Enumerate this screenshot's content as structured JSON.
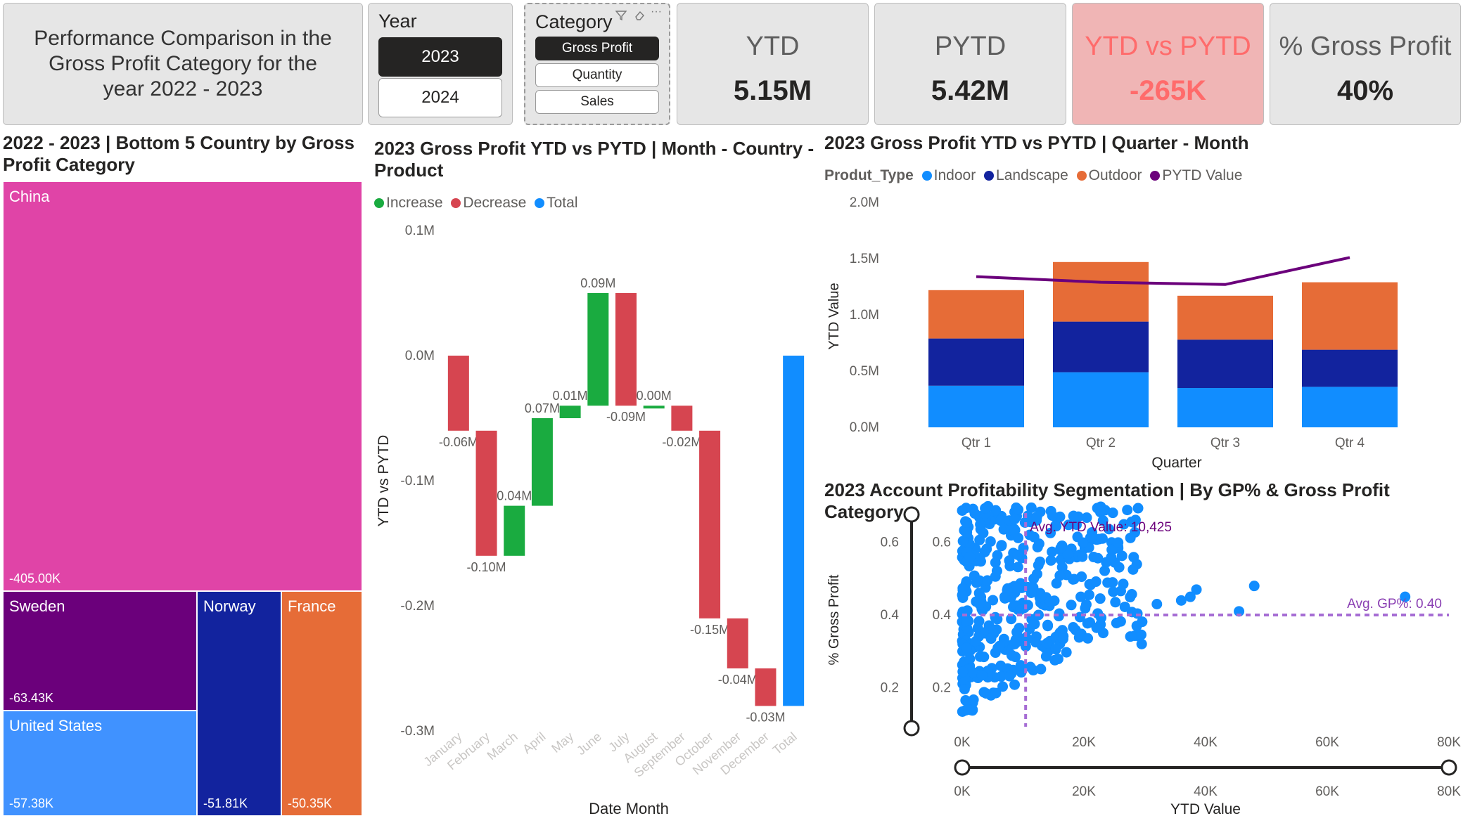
{
  "header": {
    "title_lines": [
      "Performance Comparison in the",
      "Gross Profit Category for the",
      "year 2022 - 2023"
    ]
  },
  "year_slicer": {
    "title": "Year",
    "options": [
      {
        "label": "2023",
        "selected": true
      },
      {
        "label": "2024",
        "selected": false
      }
    ]
  },
  "category_slicer": {
    "title": "Category",
    "icons": [
      "filter-icon",
      "eraser-icon",
      "more-options-icon"
    ],
    "options": [
      {
        "label": "Gross Profit",
        "selected": true
      },
      {
        "label": "Quantity",
        "selected": false
      },
      {
        "label": "Sales",
        "selected": false
      }
    ]
  },
  "kpis": [
    {
      "label": "YTD",
      "value": "5.15M",
      "highlight": false
    },
    {
      "label": "PYTD",
      "value": "5.42M",
      "highlight": false
    },
    {
      "label": "YTD vs PYTD",
      "value": "-265K",
      "highlight": true
    },
    {
      "label": "% Gross Profit",
      "value": "40%",
      "highlight": false
    }
  ],
  "colors": {
    "kpi_tile": "#e6e6e6",
    "kpi_alert_bg": "#f0b5b5",
    "kpi_alert_text": "#ff6b6b",
    "increase": "#1aab40",
    "decrease": "#d64550",
    "total": "#118dff",
    "indoor": "#118dff",
    "landscape": "#12239e",
    "outdoor": "#e66c37",
    "pytd_line": "#6b007b",
    "china": "#e044a7",
    "sweden": "#6b007b",
    "usa": "#4092ff",
    "norway": "#12239e",
    "france": "#e66c37"
  },
  "treemap": {
    "title_lines": [
      "2022 - 2023 | Bottom 5 Country by Gross",
      "Profit Category"
    ],
    "items": [
      {
        "name": "China",
        "value": "-405.00K"
      },
      {
        "name": "Sweden",
        "value": "-63.43K"
      },
      {
        "name": "United States",
        "value": "-57.38K"
      },
      {
        "name": "Norway",
        "value": "-51.81K"
      },
      {
        "name": "France",
        "value": "-50.35K"
      }
    ]
  },
  "waterfall": {
    "title_lines": [
      "2023 Gross Profit YTD vs PYTD | Month - Country -",
      "Product"
    ],
    "legend": [
      {
        "name": "Increase",
        "color": "#1aab40"
      },
      {
        "name": "Decrease",
        "color": "#d64550"
      },
      {
        "name": "Total",
        "color": "#118dff"
      }
    ]
  },
  "stacked": {
    "title": "2023 Gross Profit YTD vs PYTD | Quarter - Month",
    "legend_title": "Produt_Type",
    "legend": [
      {
        "name": "Indoor",
        "color": "#118dff"
      },
      {
        "name": "Landscape",
        "color": "#12239e"
      },
      {
        "name": "Outdoor",
        "color": "#e66c37"
      },
      {
        "name": "PYTD Value",
        "color": "#6b007b"
      }
    ]
  },
  "scatter": {
    "title": "2023 Account Profitability Segmentation | By GP% & Gross Profit Category",
    "avg_x_label": "Avg. YTD Value: 10,425",
    "avg_y_label": "Avg. GP%: 0.40"
  },
  "chart_data": [
    {
      "type": "bar",
      "subtype": "waterfall",
      "categories": [
        "January",
        "February",
        "March",
        "April",
        "May",
        "June",
        "July",
        "August",
        "September",
        "October",
        "November",
        "December",
        "Total"
      ],
      "values": [
        -0.06,
        -0.1,
        0.04,
        0.07,
        0.01,
        0.09,
        -0.09,
        0.0,
        -0.02,
        -0.15,
        -0.04,
        -0.03,
        -0.265
      ],
      "data_labels": [
        "-0.06M",
        "-0.10M",
        "0.04M",
        "0.07M",
        "0.01M",
        "0.09M",
        "-0.09M",
        "0.00M",
        "-0.02M",
        "-0.15M",
        "-0.04M",
        "-0.03M",
        ""
      ],
      "xlabel": "Date Month",
      "ylabel": "YTD vs PYTD",
      "ylim": [
        -0.3,
        0.1
      ],
      "yticks": [
        "-0.3M",
        "-0.2M",
        "-0.1M",
        "0.0M",
        "0.1M"
      ],
      "legend": "top-left"
    },
    {
      "type": "bar",
      "subtype": "stacked-column-with-line",
      "categories": [
        "Qtr 1",
        "Qtr 2",
        "Qtr 3",
        "Qtr 4"
      ],
      "series": [
        {
          "name": "Indoor",
          "values": [
            0.37,
            0.49,
            0.35,
            0.36
          ]
        },
        {
          "name": "Landscape",
          "values": [
            0.42,
            0.45,
            0.43,
            0.33
          ]
        },
        {
          "name": "Outdoor",
          "values": [
            0.43,
            0.53,
            0.39,
            0.6
          ]
        },
        {
          "name": "PYTD Value",
          "kind": "line",
          "values": [
            1.34,
            1.29,
            1.27,
            1.51
          ]
        }
      ],
      "xlabel": "Quarter",
      "ylabel": "YTD Value",
      "ylim": [
        0,
        2.0
      ],
      "yticks": [
        "0.0M",
        "0.5M",
        "1.0M",
        "1.5M",
        "2.0M"
      ],
      "legend": "top-left"
    },
    {
      "type": "scatter",
      "xlabel": "YTD Value",
      "ylabel": "% Gross Profit",
      "xlim": [
        0,
        80000
      ],
      "ylim": [
        0.1,
        0.7
      ],
      "xticks": [
        "0K",
        "20K",
        "40K",
        "60K",
        "80K"
      ],
      "yticks": [
        "0.2",
        "0.4",
        "0.6"
      ],
      "avg_x": 10425,
      "avg_y": 0.4,
      "outliers": [
        {
          "x": 72800,
          "y": 0.45
        },
        {
          "x": 48000,
          "y": 0.48
        },
        {
          "x": 45500,
          "y": 0.41
        },
        {
          "x": 38500,
          "y": 0.47
        },
        {
          "x": 37500,
          "y": 0.45
        },
        {
          "x": 36000,
          "y": 0.44
        },
        {
          "x": 32000,
          "y": 0.43
        },
        {
          "x": 29500,
          "y": 0.32
        }
      ],
      "cluster": {
        "x_range": [
          0,
          30000
        ],
        "y_range": [
          0.12,
          0.7
        ],
        "count": 420
      }
    }
  ]
}
